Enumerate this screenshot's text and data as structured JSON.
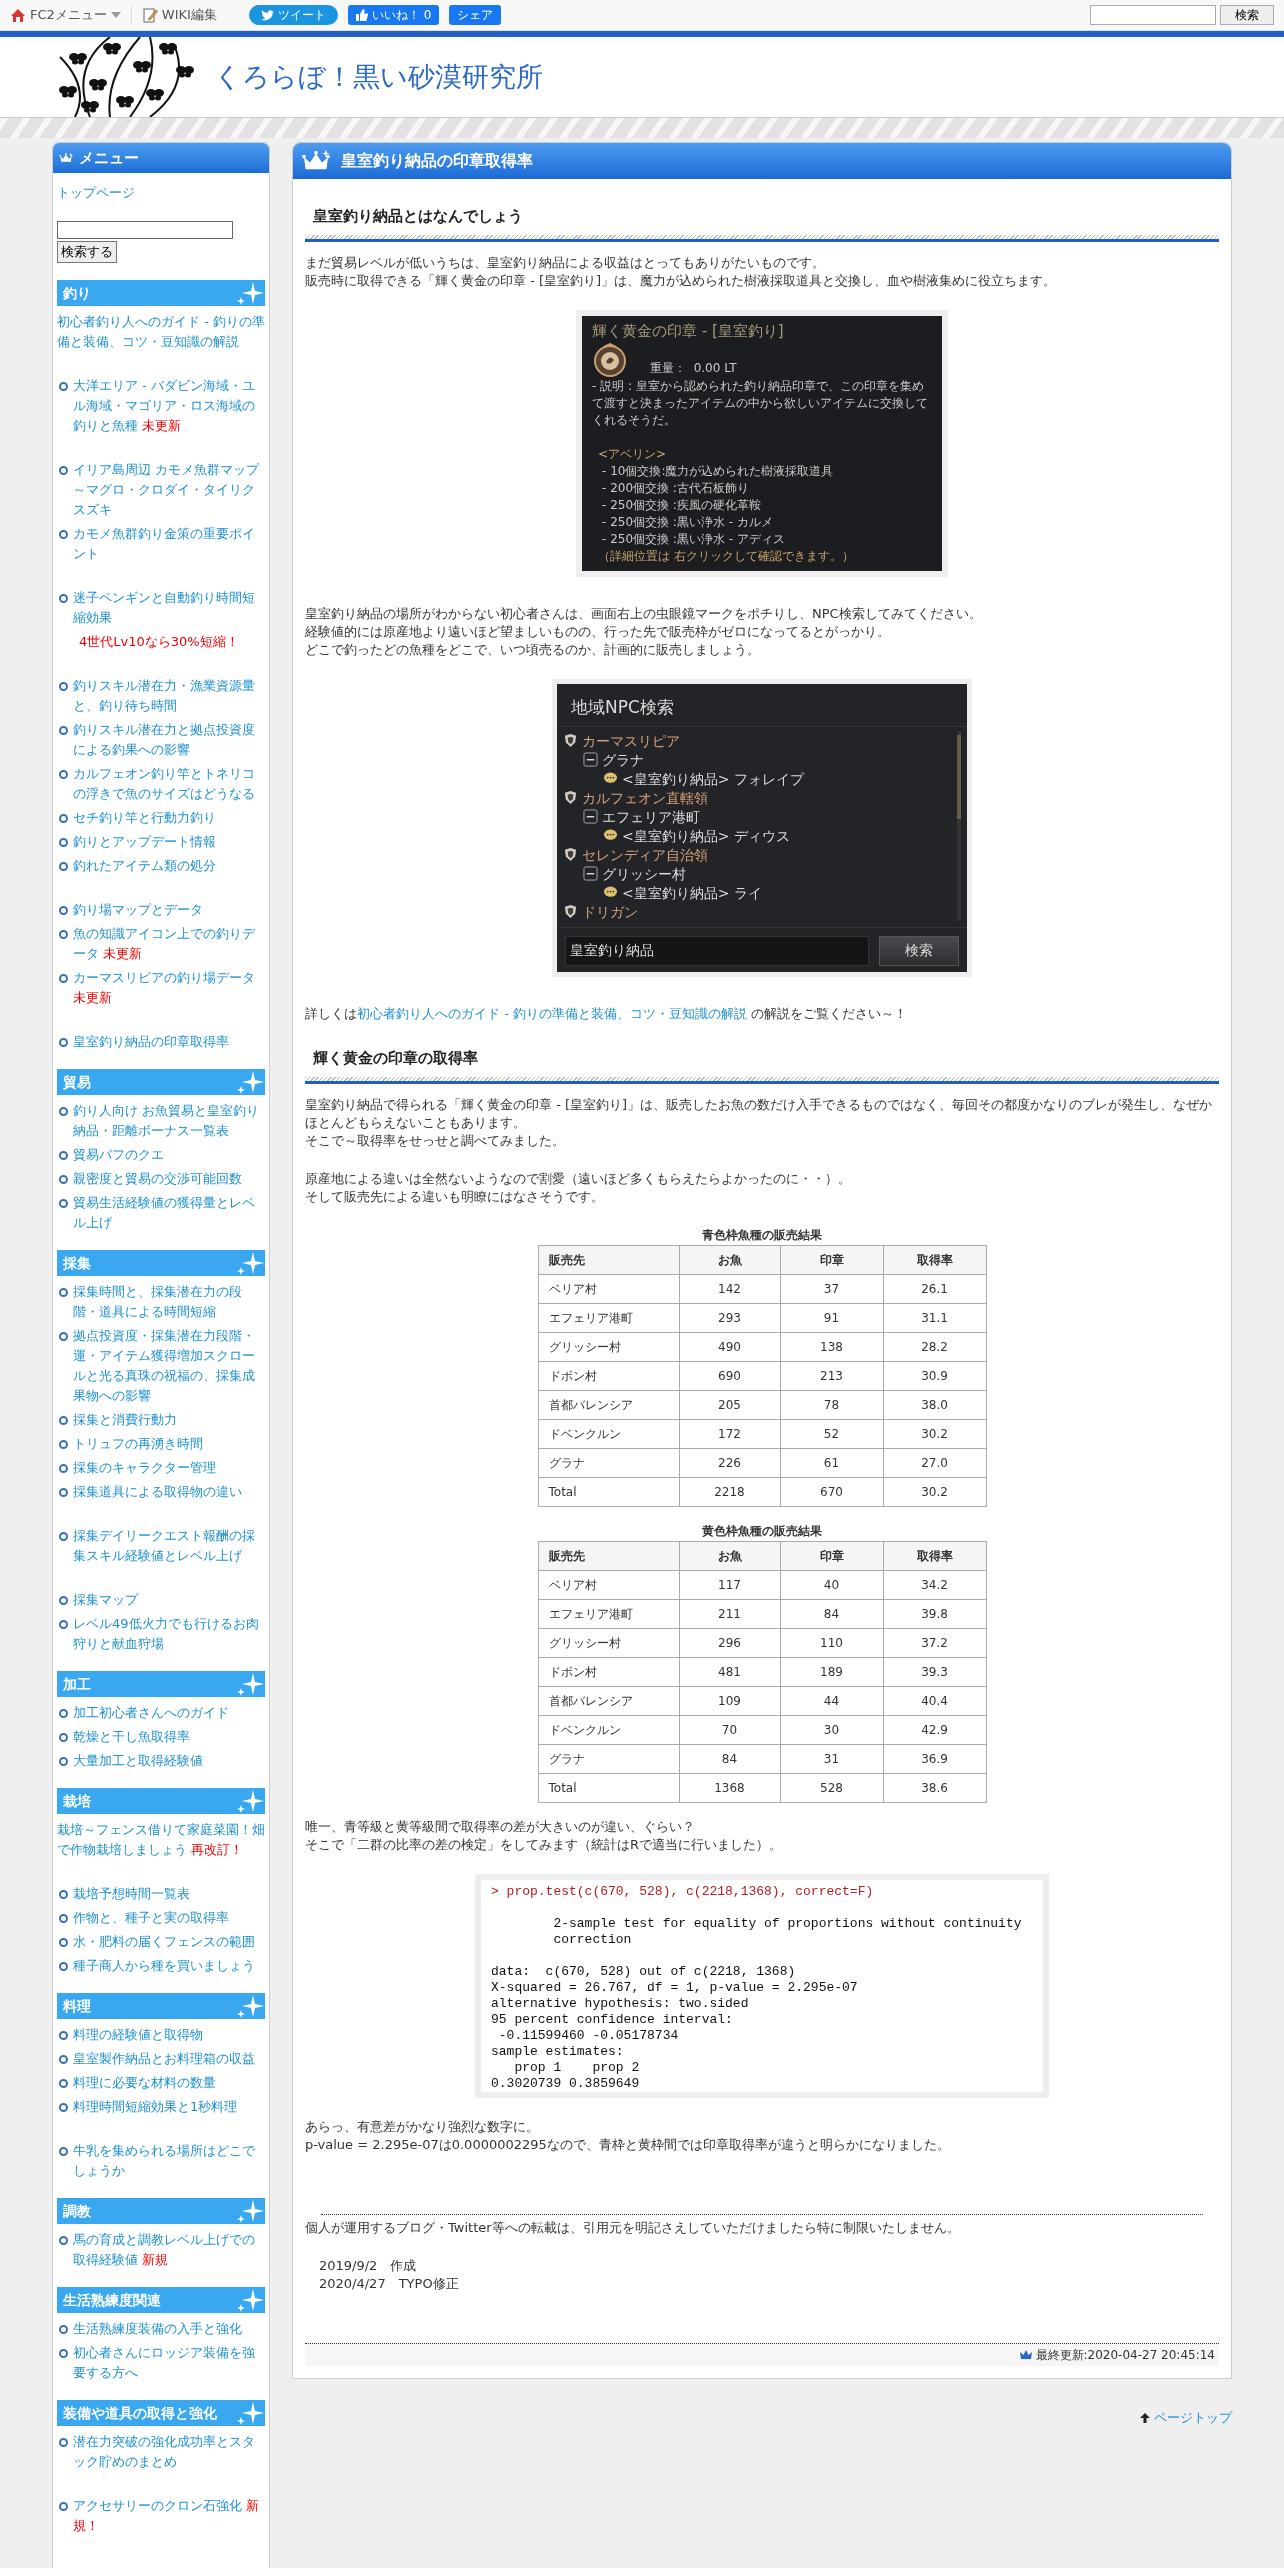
{
  "topbar": {
    "menu": "FC2メニュー",
    "wiki": "WIKI編集",
    "tweet": "ツイート",
    "like": "いいね！",
    "like_count": "0",
    "share": "シェア",
    "search_button": "検索"
  },
  "header": {
    "title": "くろらぼ！黒い砂漠研究所"
  },
  "sidebar": {
    "title": "メニュー",
    "top_link": "トップページ",
    "search_button": "検索する",
    "sections": [
      {
        "title": "釣り",
        "items": [
          {
            "kind": "link",
            "text": "初心者釣り人へのガイド - 釣りの準備と装備、コツ・豆知識の解説",
            "spaced": false
          },
          {
            "kind": "bullet",
            "text": "大洋エリア - バダビン海域・ユル海域・マゴリア・ロス海域の釣りと魚種",
            "tag": "未更新",
            "spaced": true
          },
          {
            "kind": "bullet",
            "text": "イリア島周辺 カモメ魚群マップ～マグロ・クロダイ・タイリクスズキ",
            "spaced": true
          },
          {
            "kind": "bullet",
            "text": "カモメ魚群釣り金策の重要ポイント",
            "spaced": false
          },
          {
            "kind": "bullet",
            "text": "迷子ペンギンと自動釣り時間短縮効果",
            "spaced": true
          },
          {
            "kind": "note",
            "text": "4世代Lv10なら30%短縮！",
            "spaced": false
          },
          {
            "kind": "bullet",
            "text": "釣りスキル潜在力・漁業資源量と、釣り待ち時間",
            "spaced": true
          },
          {
            "kind": "bullet",
            "text": "釣りスキル潜在力と拠点投資度による釣果への影響",
            "spaced": false
          },
          {
            "kind": "bullet",
            "text": "カルフェオン釣り竿とトネリコの浮きで魚のサイズはどうなる",
            "spaced": false
          },
          {
            "kind": "bullet",
            "text": "セチ釣り竿と行動力釣り",
            "spaced": false
          },
          {
            "kind": "bullet",
            "text": "釣りとアップデート情報",
            "spaced": false
          },
          {
            "kind": "bullet",
            "text": "釣れたアイテム類の処分",
            "spaced": false
          },
          {
            "kind": "bullet",
            "text": "釣り場マップとデータ",
            "spaced": true
          },
          {
            "kind": "bullet",
            "text": "魚の知識アイコン上での釣りデータ",
            "tag": "未更新",
            "spaced": false
          },
          {
            "kind": "bullet",
            "text": "カーマスリピアの釣り場データ",
            "tag": "未更新",
            "spaced": false
          },
          {
            "kind": "bullet",
            "text": "皇室釣り納品の印章取得率",
            "spaced": true
          }
        ]
      },
      {
        "title": "貿易",
        "items": [
          {
            "kind": "bullet",
            "text": "釣り人向け お魚貿易と皇室釣り納品・距離ボーナス一覧表",
            "spaced": false
          },
          {
            "kind": "bullet",
            "text": "貿易バフのクエ",
            "spaced": false
          },
          {
            "kind": "bullet",
            "text": "親密度と貿易の交渉可能回数",
            "spaced": false
          },
          {
            "kind": "bullet",
            "text": "貿易生活経験値の獲得量とレベル上げ",
            "spaced": false
          }
        ]
      },
      {
        "title": "採集",
        "items": [
          {
            "kind": "bullet",
            "text": "採集時間と、採集潜在力の段階・道具による時間短縮",
            "spaced": false
          },
          {
            "kind": "bullet",
            "text": "拠点投資度・採集潜在力段階・運・アイテム獲得増加スクロールと光る真珠の祝福の、採集成果物への影響",
            "spaced": false
          },
          {
            "kind": "bullet",
            "text": "採集と消費行動力",
            "spaced": false
          },
          {
            "kind": "bullet",
            "text": "トリュフの再湧き時間",
            "spaced": false
          },
          {
            "kind": "bullet",
            "text": "採集のキャラクター管理",
            "spaced": false
          },
          {
            "kind": "bullet",
            "text": "採集道具による取得物の違い",
            "spaced": false
          },
          {
            "kind": "bullet",
            "text": "採集デイリークエスト報酬の採集スキル経験値とレベル上げ",
            "spaced": true
          },
          {
            "kind": "bullet",
            "text": "採集マップ",
            "spaced": true
          },
          {
            "kind": "bullet",
            "text": "レベル49低火力でも行けるお肉狩りと献血狩場",
            "spaced": false
          }
        ]
      },
      {
        "title": "加工",
        "items": [
          {
            "kind": "bullet",
            "text": "加工初心者さんへのガイド",
            "spaced": false
          },
          {
            "kind": "bullet",
            "text": "乾燥と干し魚取得率",
            "spaced": false
          },
          {
            "kind": "bullet",
            "text": "大量加工と取得経験値",
            "spaced": false
          }
        ]
      },
      {
        "title": "栽培",
        "items": [
          {
            "kind": "link",
            "text": "栽培～フェンス借りて家庭菜園！畑で作物栽培しましょう",
            "tag": "再改訂！",
            "spaced": false
          },
          {
            "kind": "bullet",
            "text": "栽培予想時間一覧表",
            "spaced": true
          },
          {
            "kind": "bullet",
            "text": "作物と、種子と実の取得率",
            "spaced": false
          },
          {
            "kind": "bullet",
            "text": "水・肥料の届くフェンスの範囲",
            "spaced": false
          },
          {
            "kind": "bullet",
            "text": "種子商人から種を買いましょう",
            "spaced": false
          }
        ]
      },
      {
        "title": "料理",
        "items": [
          {
            "kind": "bullet",
            "text": "料理の経験値と取得物",
            "spaced": false
          },
          {
            "kind": "bullet",
            "text": "皇室製作納品とお料理箱の収益",
            "spaced": false
          },
          {
            "kind": "bullet",
            "text": "料理に必要な材料の数量",
            "spaced": false
          },
          {
            "kind": "bullet",
            "text": "料理時間短縮効果と1秒料理",
            "spaced": false
          },
          {
            "kind": "bullet",
            "text": "牛乳を集められる場所はどこでしょうか",
            "spaced": true
          }
        ]
      },
      {
        "title": "調教",
        "items": [
          {
            "kind": "bullet",
            "text": "馬の育成と調教レベル上げでの取得経験値",
            "tag": "新規",
            "spaced": false
          }
        ]
      },
      {
        "title": "生活熟練度関連",
        "items": [
          {
            "kind": "bullet",
            "text": "生活熟練度装備の入手と強化",
            "spaced": false
          },
          {
            "kind": "bullet",
            "text": "初心者さんにロッジア装備を強要する方へ",
            "spaced": false
          }
        ]
      },
      {
        "title": "装備や道具の取得と強化",
        "items": [
          {
            "kind": "bullet",
            "text": "潜在力突破の強化成功率とスタック貯めのまとめ",
            "spaced": false
          },
          {
            "kind": "bullet",
            "text": "アクセサリーのクロン石強化",
            "tag": "新規！",
            "spaced": true
          }
        ]
      }
    ]
  },
  "article": {
    "title": "皇室釣り納品の印章取得率",
    "blocks": [
      {
        "kind": "heading",
        "text": "皇室釣り納品とはなんでしょう"
      },
      {
        "kind": "paragraph",
        "lines": [
          "まだ貿易レベルが低いうちは、皇室釣り納品による収益はとってもありがたいものです。",
          "販売時に取得できる「輝く黄金の印章 - [皇室釣り]」は、魔力が込められた樹液採取道具と交換し、血や樹液集めに役立ちます。"
        ]
      },
      {
        "kind": "tooltip",
        "title": "輝く黄金の印章 - [皇室釣り]",
        "weight_label": "重量：",
        "weight": "0.00 LT",
        "description": "- 説明 : 皇室から認められた釣り納品印章で、この印章を集めて渡すと決まったアイテムの中から欲しいアイテムに交換してくれるそうだ。",
        "group": "<アベリン>",
        "exchanges": [
          "- 10個交換:魔力が込められた樹液採取道具",
          "- 200個交換 :古代石板飾り",
          "- 250個交換 :疾風の硬化革鞍",
          "- 250個交換 :黒い浄水 - カルメ",
          "- 250個交換 :黒い浄水 - アディス"
        ],
        "note": "（詳細位置は 右クリックして確認できます。）"
      },
      {
        "kind": "paragraph",
        "lines": [
          "皇室釣り納品の場所がわからない初心者さんは、画面右上の虫眼鏡マークをポチりし、NPC検索してみてください。",
          "経験値的には原産地より遠いほど望ましいものの、行った先で販売枠がゼロになってるとがっかり。",
          "どこで釣ったどの魚種をどこで、いつ頃売るのか、計画的に販売しましょう。"
        ]
      },
      {
        "kind": "npc_search",
        "title": "地域NPC検索",
        "tree": [
          {
            "label": "カーマスリピア",
            "children": [
              {
                "label": "グラナ",
                "children": [
                  {
                    "label": "<皇室釣り納品> フォレイプ"
                  }
                ]
              }
            ]
          },
          {
            "label": "カルフェオン直轄領",
            "children": [
              {
                "label": "エフェリア港町",
                "children": [
                  {
                    "label": "<皇室釣り納品> ディウス"
                  }
                ]
              }
            ]
          },
          {
            "label": "セレンディア自治領",
            "children": [
              {
                "label": "グリッシー村",
                "children": [
                  {
                    "label": "<皇室釣り納品> ライ"
                  }
                ]
              }
            ]
          },
          {
            "label": "ドリガン"
          }
        ],
        "query": "皇室釣り納品",
        "button": "検索"
      },
      {
        "kind": "link_line",
        "before": "詳しくは",
        "link": "初心者釣り人へのガイド - 釣りの準備と装備、コツ・豆知識の解説",
        "after": " の解説をご覧ください～！"
      },
      {
        "kind": "heading",
        "text": "輝く黄金の印章の取得率"
      },
      {
        "kind": "paragraph",
        "lines": [
          "皇室釣り納品で得られる「輝く黄金の印章 - [皇室釣り]」は、販売したお魚の数だけ入手できるものではなく、毎回その都度かなりのブレが発生し、なぜかほとんどもらえないこともあります。",
          "そこで～取得率をせっせと調べてみました。"
        ]
      },
      {
        "kind": "paragraph",
        "lines": [
          "原産地による違いは全然ないようなので割愛（遠いほど多くもらえたらよかったのに・・）。",
          "そして販売先による違いも明瞭にはなさそうです。"
        ]
      },
      {
        "kind": "table",
        "caption": "青色枠魚種の販売結果",
        "columns": [
          "販売先",
          "お魚",
          "印章",
          "取得率"
        ],
        "rows": [
          [
            "ベリア村",
            "142",
            "37",
            "26.1"
          ],
          [
            "エフェリア港町",
            "293",
            "91",
            "31.1"
          ],
          [
            "グリッシー村",
            "490",
            "138",
            "28.2"
          ],
          [
            "ドボン村",
            "690",
            "213",
            "30.9"
          ],
          [
            "首都バレンシア",
            "205",
            "78",
            "38.0"
          ],
          [
            "ドベンクルン",
            "172",
            "52",
            "30.2"
          ],
          [
            "グラナ",
            "226",
            "61",
            "27.0"
          ],
          [
            "Total",
            "2218",
            "670",
            "30.2"
          ]
        ]
      },
      {
        "kind": "table",
        "caption": "黄色枠魚種の販売結果",
        "columns": [
          "販売先",
          "お魚",
          "印章",
          "取得率"
        ],
        "rows": [
          [
            "ベリア村",
            "117",
            "40",
            "34.2"
          ],
          [
            "エフェリア港町",
            "211",
            "84",
            "39.8"
          ],
          [
            "グリッシー村",
            "296",
            "110",
            "37.2"
          ],
          [
            "ドボン村",
            "481",
            "189",
            "39.3"
          ],
          [
            "首都バレンシア",
            "109",
            "44",
            "40.4"
          ],
          [
            "ドベンクルン",
            "70",
            "30",
            "42.9"
          ],
          [
            "グラナ",
            "84",
            "31",
            "36.9"
          ],
          [
            "Total",
            "1368",
            "528",
            "38.6"
          ]
        ]
      },
      {
        "kind": "paragraph",
        "lines": [
          "唯一、青等級と黄等級間で取得率の差が大きいのが違い、ぐらい？",
          "そこで「二群の比率の差の検定」をしてみます（統計はRで適当に行いました）。"
        ]
      },
      {
        "kind": "code",
        "prompt": "> prop.test(c(670, 528), c(2218,1368), correct=F)",
        "output": [
          [
            "        2-sample test for equality of proportions without continuity",
            "        correction"
          ],
          [
            "data:  c(670, 528) out of c(2218, 1368)",
            "X-squared = 26.767, df = 1, p-value = 2.295e-07",
            "alternative hypothesis: two.sided",
            "95 percent confidence interval:",
            " -0.11599460 -0.05178734",
            "sample estimates:",
            "   prop 1    prop 2",
            "0.3020739 0.3859649"
          ]
        ]
      },
      {
        "kind": "paragraph",
        "lines": [
          "あらっ、有意差がかなり強烈な数字に。",
          "p-value = 2.295e-07は0.0000002295なので、青枠と黄枠間では印章取得率が違うと明らかになりました。"
        ]
      },
      {
        "kind": "notice",
        "text": "個人が運用するブログ・Twitter等への転載は、引用元を明記さえしていただけましたら特に制限いたしません。"
      },
      {
        "kind": "dates",
        "lines": [
          "2019/9/2　作成",
          "2020/4/27　TYPO修正"
        ]
      }
    ],
    "updated": "最終更新:2020-04-27 20:45:14"
  },
  "page_top": "ページトップ"
}
